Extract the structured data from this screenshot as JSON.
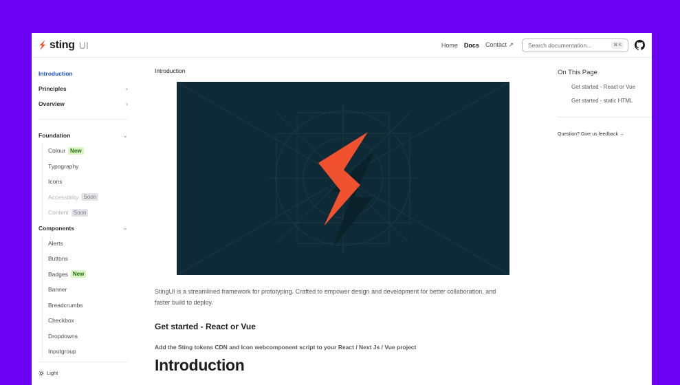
{
  "brand": {
    "name": "sting",
    "suffix": "UI",
    "accent": "#f0522f"
  },
  "header": {
    "nav": [
      {
        "label": "Home"
      },
      {
        "label": "Docs"
      },
      {
        "label": "Contact ↗"
      }
    ],
    "search_placeholder": "Search documentation...",
    "shortcut": "⌘ K"
  },
  "sidebar": {
    "top": [
      {
        "label": "Introduction"
      },
      {
        "label": "Principles",
        "chevron": "›"
      },
      {
        "label": "Overview",
        "chevron": "›"
      }
    ],
    "foundation": {
      "label": "Foundation",
      "chevron": "⌄",
      "items": [
        {
          "label": "Colour",
          "badge": "New"
        },
        {
          "label": "Typography"
        },
        {
          "label": "Icons"
        },
        {
          "label": "Accessiblity",
          "badge": "Soon"
        },
        {
          "label": "Content",
          "badge": "Soon"
        }
      ]
    },
    "components": {
      "label": "Components",
      "chevron": "⌄",
      "items": [
        {
          "label": "Alerts"
        },
        {
          "label": "Buttons"
        },
        {
          "label": "Badges",
          "badge": "New"
        },
        {
          "label": "Banner"
        },
        {
          "label": "Breadcrumbs"
        },
        {
          "label": "Checkbox"
        },
        {
          "label": "Dropdowns"
        },
        {
          "label": "Inputgroup"
        }
      ]
    },
    "theme": "Light"
  },
  "main": {
    "breadcrumb": "Introduction",
    "intro": "StingUI is a streamlined framework for prototyping. Crafted to empower design and development for better collaboration, and faster build to deploy.",
    "get_started_heading": "Get started - React or Vue",
    "get_started_note": "Add the Sting tokens CDN and Icon webcomponent script to your React / Next Js / Vue project",
    "page_heading": "Introduction"
  },
  "toc": {
    "title": "On This Page",
    "items": [
      {
        "label": "Get started - React or Vue"
      },
      {
        "label": "Get started - static HTML"
      }
    ],
    "feedback": "Question? Give us feedback →"
  }
}
